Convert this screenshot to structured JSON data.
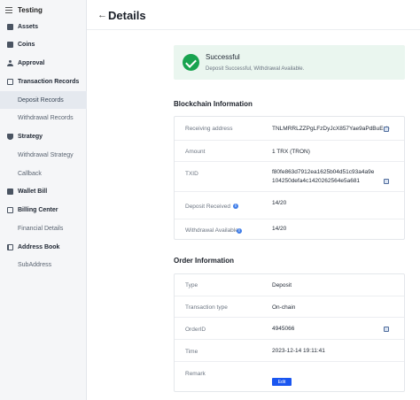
{
  "app": {
    "title": "Testing"
  },
  "sidebar": {
    "items": [
      {
        "label": "Assets"
      },
      {
        "label": "Coins"
      },
      {
        "label": "Approval"
      },
      {
        "label": "Transaction Records"
      },
      {
        "label": "Deposit Records"
      },
      {
        "label": "Withdrawal Records"
      },
      {
        "label": "Strategy"
      },
      {
        "label": "Withdrawal Strategy"
      },
      {
        "label": "Callback"
      },
      {
        "label": "Wallet Bill"
      },
      {
        "label": "Billing Center"
      },
      {
        "label": "Financial Details"
      },
      {
        "label": "Address Book"
      },
      {
        "label": "SubAddress"
      }
    ]
  },
  "header": {
    "back_icon": "arrow-left-icon",
    "title": "Details"
  },
  "banner": {
    "title": "Successful",
    "desc": "Deposit Successful, Withdrawal Available.",
    "color": "#18a34f"
  },
  "blockchain": {
    "title": "Blockchain Information",
    "receiving_address": {
      "label": "Receiving address",
      "value": "TNLMRRLZZPgLFzDyJcX857Yae9aPdBuEcb"
    },
    "amount": {
      "label": "Amount",
      "value": "1 TRX (TRON)"
    },
    "txid": {
      "label": "TXID",
      "value_line1": "f80fe863d7912ea1625b04d51c93a4a9e",
      "value_line2": "104250defa4c1420262564e5a681"
    },
    "deposit_received": {
      "label": "Deposit Received",
      "value": "14/20"
    },
    "withdrawal_available": {
      "label": "Withdrawal Available",
      "value": "14/20"
    }
  },
  "order": {
    "title": "Order Information",
    "type": {
      "label": "Type",
      "value": "Deposit"
    },
    "transaction_type": {
      "label": "Transaction type",
      "value": "On-chain"
    },
    "order_id": {
      "label": "OrderID",
      "value": "4945066"
    },
    "time": {
      "label": "Time",
      "value": "2023-12-14 19:11:41"
    },
    "remark": {
      "label": "Remark",
      "edit_label": "Edit"
    }
  },
  "colors": {
    "accent": "#1a56f0",
    "success": "#18a34f",
    "sidebar_bg": "#f5f6f8"
  }
}
